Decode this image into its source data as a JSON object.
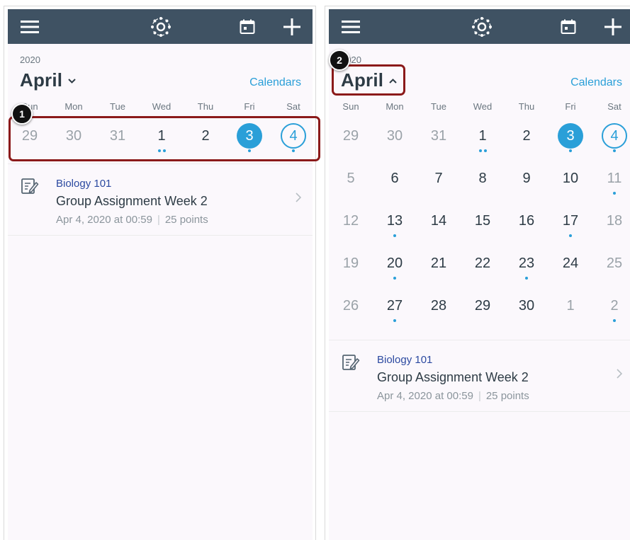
{
  "left_screen": {
    "year": "2020",
    "month": "April",
    "calendars_link": "Calendars",
    "weekdays": [
      "Sun",
      "Mon",
      "Tue",
      "Wed",
      "Thu",
      "Fri",
      "Sat"
    ],
    "week_row": [
      "29",
      "30",
      "31",
      "1",
      "2",
      "3",
      "4"
    ],
    "event": {
      "course": "Biology 101",
      "title": "Group Assignment Week 2",
      "date": "Apr 4, 2020 at 00:59",
      "points": "25 points"
    },
    "callout_number": "1"
  },
  "right_screen": {
    "year": "2020",
    "month": "April",
    "calendars_link": "Calendars",
    "weekdays": [
      "Sun",
      "Mon",
      "Tue",
      "Wed",
      "Thu",
      "Fri",
      "Sat"
    ],
    "weeks": [
      [
        "29",
        "30",
        "31",
        "1",
        "2",
        "3",
        "4"
      ],
      [
        "5",
        "6",
        "7",
        "8",
        "9",
        "10",
        "11"
      ],
      [
        "12",
        "13",
        "14",
        "15",
        "16",
        "17",
        "18"
      ],
      [
        "19",
        "20",
        "21",
        "22",
        "23",
        "24",
        "25"
      ],
      [
        "26",
        "27",
        "28",
        "29",
        "30",
        "1",
        "2"
      ]
    ],
    "event": {
      "course": "Biology 101",
      "title": "Group Assignment Week 2",
      "date": "Apr 4, 2020 at 00:59",
      "points": "25 points"
    },
    "callout_number": "2"
  },
  "icons": {
    "menu": "hamburger-menu-icon",
    "logo": "canvas-logo-icon",
    "calendar": "calendar-icon",
    "add": "plus-icon",
    "assignment": "assignment-icon",
    "chevron": "chevron-right-icon"
  },
  "colors": {
    "topbar": "#3f5263",
    "accent": "#2a9fd8",
    "text": "#2d3b45",
    "muted": "#9aa2a8",
    "course": "#2b49a0",
    "callout": "#8b1a1a"
  }
}
